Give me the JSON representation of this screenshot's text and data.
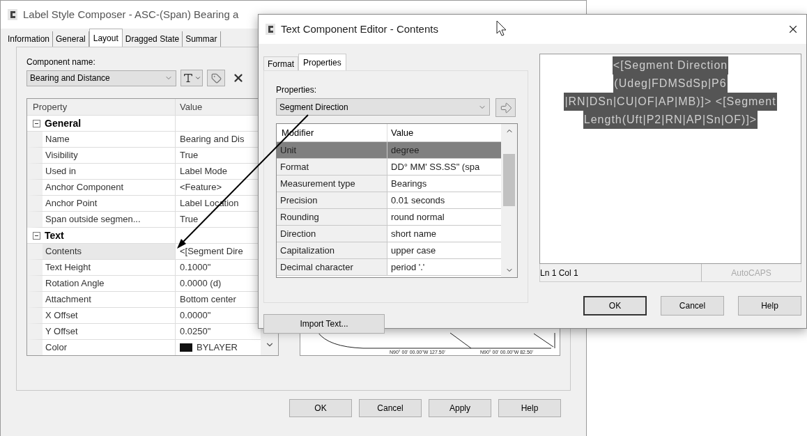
{
  "main_window": {
    "title": "Label Style Composer - ASC-(Span) Bearing a",
    "tabs": [
      {
        "label": "Information",
        "selected": false
      },
      {
        "label": "General",
        "selected": false
      },
      {
        "label": "Layout",
        "selected": true
      },
      {
        "label": "Dragged State",
        "selected": false
      },
      {
        "label": "Summar",
        "selected": false
      }
    ],
    "component_name": {
      "label": "Component name:",
      "value": "Bearing and Distance"
    },
    "property_table": {
      "columns": [
        "Property",
        "Value"
      ],
      "groups": [
        {
          "name": "General",
          "expanded": true,
          "rows": [
            {
              "property": "Name",
              "value": "Bearing and Dis",
              "kind": "text",
              "selected": false
            },
            {
              "property": "Visibility",
              "value": "True",
              "kind": "text",
              "selected": false
            },
            {
              "property": "Used in",
              "value": "Label Mode",
              "kind": "text",
              "selected": false
            },
            {
              "property": "Anchor Component",
              "value": "<Feature>",
              "kind": "text",
              "selected": false
            },
            {
              "property": "Anchor Point",
              "value": "Label Location",
              "kind": "text",
              "selected": false
            },
            {
              "property": "Span outside segmen...",
              "value": "True",
              "kind": "text",
              "selected": false
            }
          ]
        },
        {
          "name": "Text",
          "expanded": true,
          "rows": [
            {
              "property": "Contents",
              "value": "<[Segment Dire",
              "kind": "text",
              "selected": true
            },
            {
              "property": "Text Height",
              "value": "0.1000\"",
              "kind": "text",
              "selected": false
            },
            {
              "property": "Rotation Angle",
              "value": "0.0000 (d)",
              "kind": "text",
              "selected": false
            },
            {
              "property": "Attachment",
              "value": "Bottom center",
              "kind": "text",
              "selected": false
            },
            {
              "property": "X Offset",
              "value": "0.0000\"",
              "kind": "text",
              "selected": false
            },
            {
              "property": "Y Offset",
              "value": "0.0250\"",
              "kind": "text",
              "selected": false
            },
            {
              "property": "Color",
              "value": "BYLAYER",
              "kind": "color",
              "selected": false
            }
          ]
        }
      ]
    },
    "preview": {
      "labels": [
        "N90° 00' 00.00\"W 127.50'",
        "N90° 00' 00.00\"W 82.50'"
      ]
    },
    "buttons": [
      "OK",
      "Cancel",
      "Apply",
      "Help"
    ]
  },
  "editor_window": {
    "title": "Text Component Editor - Contents",
    "tabs": [
      {
        "label": "Format",
        "selected": false
      },
      {
        "label": "Properties",
        "selected": true
      }
    ],
    "properties": {
      "label": "Properties:",
      "value": "Segment Direction"
    },
    "modifier_table": {
      "columns": [
        "Modifier",
        "Value"
      ],
      "rows": [
        {
          "modifier": "Unit",
          "value": "degree",
          "selected": true
        },
        {
          "modifier": "Format",
          "value": "DD° MM' SS.SS\" (spa",
          "selected": false
        },
        {
          "modifier": "Measurement type",
          "value": "Bearings",
          "selected": false
        },
        {
          "modifier": "Precision",
          "value": "0.01 seconds",
          "selected": false
        },
        {
          "modifier": "Rounding",
          "value": "round normal",
          "selected": false
        },
        {
          "modifier": "Direction",
          "value": "short name",
          "selected": false
        },
        {
          "modifier": "Capitalization",
          "value": "upper case",
          "selected": false
        },
        {
          "modifier": "Decimal character",
          "value": "period '.'",
          "selected": false
        }
      ]
    },
    "import_button": "Import Text...",
    "editor": {
      "selected": true,
      "lines": [
        "<[Segment Direction",
        "(Udeg|FDMSdSp|P6",
        "|RN|DSn|CU|OF|AP|MB)]> <[Segment",
        "Length(Uft|P2|RN|AP|Sn|OF)]>"
      ]
    },
    "status": {
      "position": "Ln 1 Col 1",
      "mode": "AutoCAPS"
    },
    "buttons": [
      {
        "label": "OK",
        "default": true
      },
      {
        "label": "Cancel",
        "default": false
      },
      {
        "label": "Help",
        "default": false
      }
    ]
  }
}
